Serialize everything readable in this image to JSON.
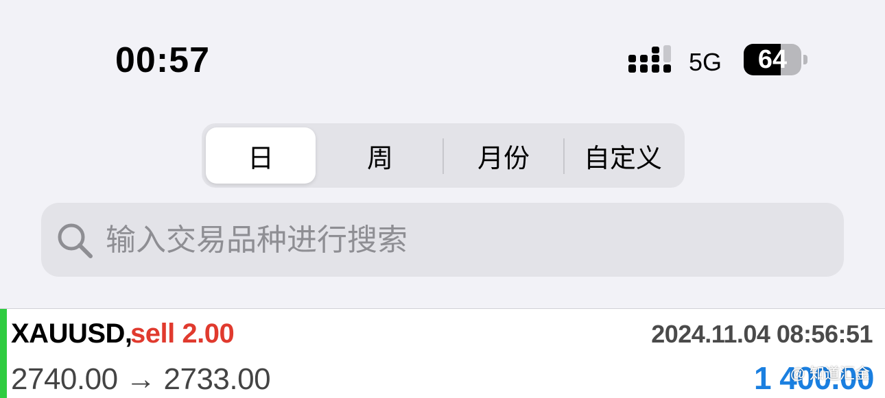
{
  "status_bar": {
    "time": "00:57",
    "network": "5G",
    "battery_percent": "64",
    "battery_level": 0.64,
    "signal_icon": "signal-bars-icon"
  },
  "period_tabs": {
    "items": [
      {
        "label": "日",
        "active": true
      },
      {
        "label": "周",
        "active": false
      },
      {
        "label": "月份",
        "active": false
      },
      {
        "label": "自定义",
        "active": false
      }
    ]
  },
  "search": {
    "icon": "search-icon",
    "placeholder": "输入交易品种进行搜索"
  },
  "trades": [
    {
      "symbol": "XAUUSD,",
      "side": "sell 2.00",
      "time": "2024.11.04 08:56:51",
      "prices": "2740.00 → 2733.00",
      "profit": "1 400.00",
      "colors": {
        "bar": "#2ecc40",
        "side": "#e03a2e",
        "profit": "#1a7fe0"
      }
    }
  ],
  "watermark": "@ 知道汇金"
}
